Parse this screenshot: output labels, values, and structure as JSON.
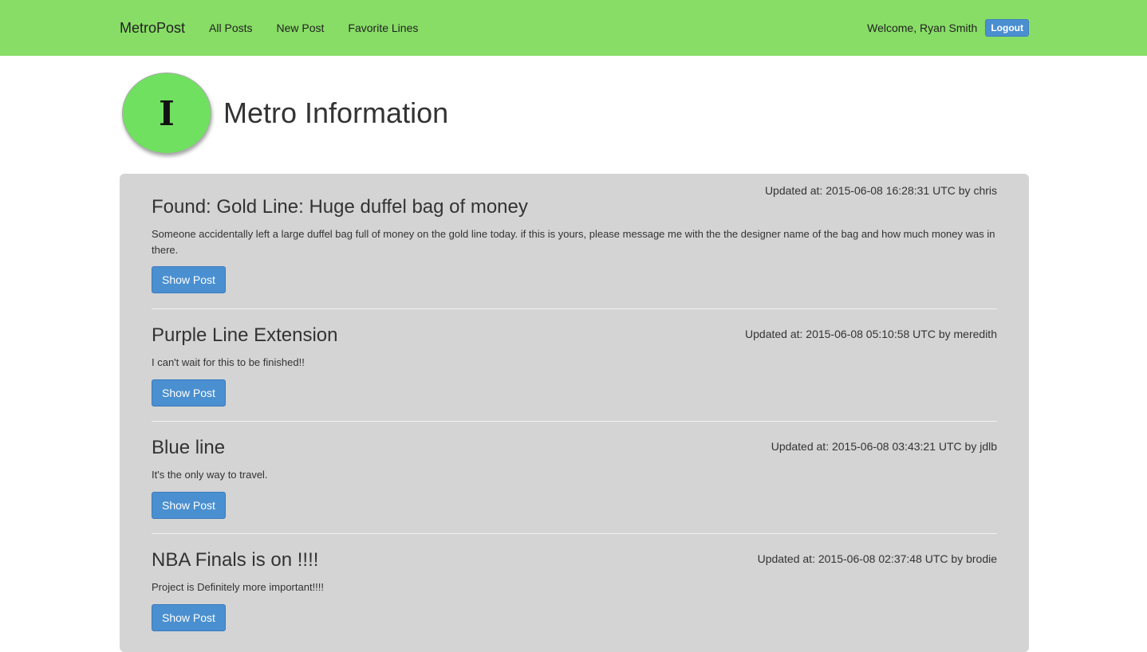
{
  "navbar": {
    "brand": "MetroPost",
    "links": [
      "All Posts",
      "New Post",
      "Favorite Lines"
    ],
    "welcome": "Welcome, Ryan Smith",
    "logout_label": "Logout"
  },
  "header": {
    "logo_letter": "I",
    "title": "Metro Information"
  },
  "posts": [
    {
      "title": "Found: Gold Line: Huge duffel bag of money",
      "body": "Someone accidentally left a large duffel bag full of money on the gold line today. if this is yours, please message me with the the designer name of the bag and how much money was in there.",
      "meta": "Updated at: 2015-06-08 16:28:31 UTC by chris",
      "button": "Show Post"
    },
    {
      "title": "Purple Line Extension",
      "body": "I can't wait for this to be finished!!",
      "meta": "Updated at: 2015-06-08 05:10:58 UTC by meredith",
      "button": "Show Post"
    },
    {
      "title": "Blue line",
      "body": "It's the only way to travel.",
      "meta": "Updated at: 2015-06-08 03:43:21 UTC by jdlb",
      "button": "Show Post"
    },
    {
      "title": "NBA Finals is on !!!!",
      "body": "Project is Definitely more important!!!!",
      "meta": "Updated at: 2015-06-08 02:37:48 UTC by brodie",
      "button": "Show Post"
    }
  ],
  "colors": {
    "navbar": "#88dd66",
    "logo": "#70e060",
    "panel": "#d4d4d4",
    "button": "#4a8fd0"
  }
}
